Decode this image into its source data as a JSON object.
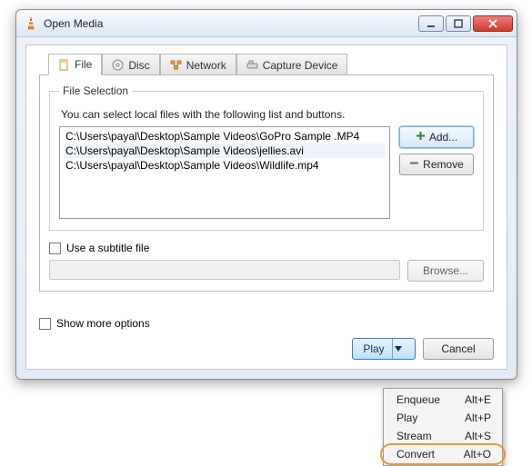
{
  "window": {
    "title": "Open Media"
  },
  "tabs": {
    "file": "File",
    "disc": "Disc",
    "network": "Network",
    "capture": "Capture Device"
  },
  "fileSelection": {
    "legend": "File Selection",
    "hint": "You can select local files with the following list and buttons.",
    "files": [
      "C:\\Users\\payal\\Desktop\\Sample Videos\\GoPro Sample .MP4",
      "C:\\Users\\payal\\Desktop\\Sample Videos\\jellies.avi",
      "C:\\Users\\payal\\Desktop\\Sample Videos\\Wildlife.mp4"
    ],
    "addLabel": "Add...",
    "removeLabel": "Remove"
  },
  "subtitle": {
    "checkboxLabel": "Use a subtitle file",
    "browseLabel": "Browse..."
  },
  "showMore": {
    "label": "Show more options"
  },
  "buttons": {
    "play": "Play",
    "cancel": "Cancel"
  },
  "menu": {
    "items": [
      {
        "label": "Enqueue",
        "accel": "Alt+E"
      },
      {
        "label": "Play",
        "accel": "Alt+P"
      },
      {
        "label": "Stream",
        "accel": "Alt+S"
      },
      {
        "label": "Convert",
        "accel": "Alt+O"
      }
    ]
  }
}
